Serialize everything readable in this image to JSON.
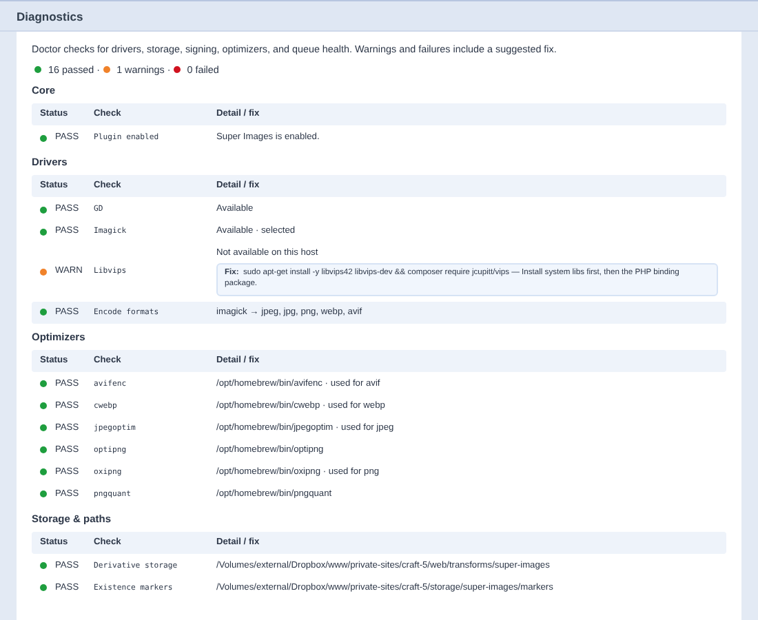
{
  "panel": {
    "title": "Diagnostics"
  },
  "description": "Doctor checks for drivers, storage, signing, optimizers, and queue health. Warnings and failures include a suggested fix.",
  "summary": [
    {
      "text": "16 passed ·",
      "color": "#1e9e3e"
    },
    {
      "text": "1 warnings ·",
      "color": "#f0822a"
    },
    {
      "text": "0 failed",
      "color": "#d0121f"
    }
  ],
  "sections": [
    {
      "title": "Core",
      "columns": [
        "Status",
        "Check",
        "Detail / fix"
      ],
      "rows": [
        {
          "color": "#1e9e3e",
          "label": "PASS",
          "check": "Plugin enabled",
          "detail": "Super Images is enabled."
        }
      ]
    },
    {
      "title": "Drivers",
      "columns": [
        "Status",
        "Check",
        "Detail / fix"
      ],
      "rows": [
        {
          "color": "#1e9e3e",
          "label": "PASS",
          "check": "GD",
          "detail": "Available"
        },
        {
          "color": "#1e9e3e",
          "label": "PASS",
          "check": "Imagick",
          "detail": "Available · selected"
        },
        {
          "color": "#f0822a",
          "label": "WARN",
          "check": "Libvips",
          "detail": "Not available on this host",
          "fix": "**Fix:**  sudo apt-get install -y libvips42 libvips-dev && composer require jcupitt/vips — Install system libs first, then the PHP binding package."
        },
        {
          "color": "#1e9e3e",
          "label": "PASS",
          "check": "Encode formats",
          "detail": "imagick → jpeg, jpg, png, webp, avif",
          "highlighted": true
        }
      ]
    },
    {
      "title": "Optimizers",
      "columns": [
        "Status",
        "Check",
        "Detail / fix"
      ],
      "rows": [
        {
          "color": "#1e9e3e",
          "label": "PASS",
          "check": "avifenc",
          "detail": "/opt/homebrew/bin/avifenc · used for avif"
        },
        {
          "color": "#1e9e3e",
          "label": "PASS",
          "check": "cwebp",
          "detail": "/opt/homebrew/bin/cwebp · used for webp"
        },
        {
          "color": "#1e9e3e",
          "label": "PASS",
          "check": "jpegoptim",
          "detail": "/opt/homebrew/bin/jpegoptim · used for jpeg"
        },
        {
          "color": "#1e9e3e",
          "label": "PASS",
          "check": "optipng",
          "detail": "/opt/homebrew/bin/optipng"
        },
        {
          "color": "#1e9e3e",
          "label": "PASS",
          "check": "oxipng",
          "detail": "/opt/homebrew/bin/oxipng · used for png"
        },
        {
          "color": "#1e9e3e",
          "label": "PASS",
          "check": "pngquant",
          "detail": "/opt/homebrew/bin/pngquant"
        }
      ]
    },
    {
      "title": "Storage & paths",
      "columns": [
        "Status",
        "Check",
        "Detail / fix"
      ],
      "rows": [
        {
          "color": "#1e9e3e",
          "label": "PASS",
          "check": "Derivative storage",
          "detail": "/Volumes/external/Dropbox/www/private-sites/craft-5/web/transforms/super-images"
        },
        {
          "color": "#1e9e3e",
          "label": "PASS",
          "check": "Existence markers",
          "detail": "/Volumes/external/Dropbox/www/private-sites/craft-5/storage/super-images/markers"
        }
      ]
    }
  ]
}
